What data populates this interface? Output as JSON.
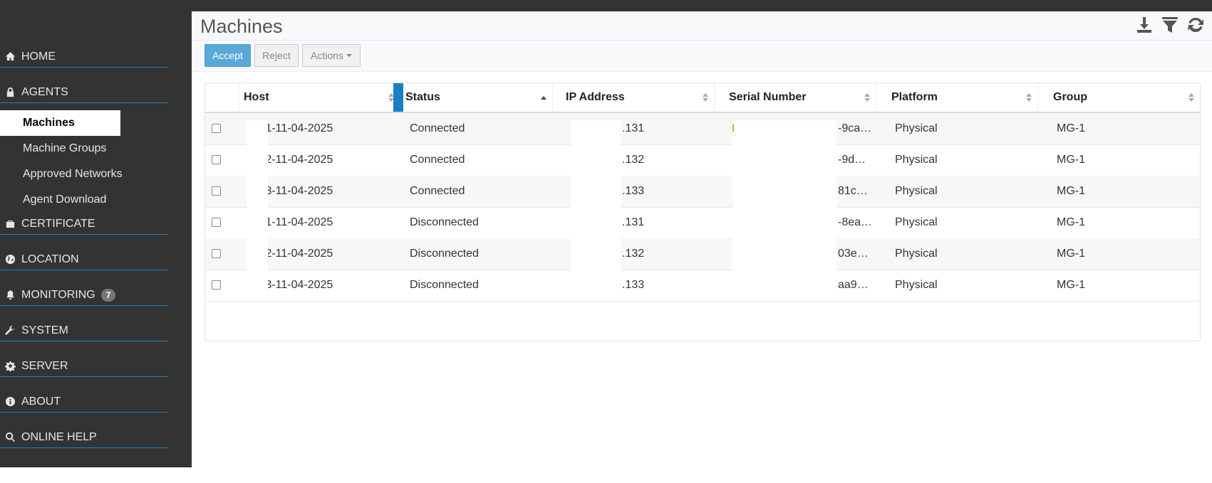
{
  "sidebar": {
    "items": [
      {
        "label": "HOME",
        "icon": "home-icon"
      },
      {
        "label": "AGENTS",
        "icon": "lock-icon"
      },
      {
        "label": "CERTIFICATE",
        "icon": "certificate-icon"
      },
      {
        "label": "LOCATION",
        "icon": "globe-icon"
      },
      {
        "label": "MONITORING",
        "icon": "bell-icon",
        "badge": "7"
      },
      {
        "label": "SYSTEM",
        "icon": "wrench-icon"
      },
      {
        "label": "SERVER",
        "icon": "gear-icon"
      },
      {
        "label": "ABOUT",
        "icon": "info-icon"
      },
      {
        "label": "ONLINE HELP",
        "icon": "search-icon"
      }
    ],
    "agents_sub": [
      "Machines",
      "Machine Groups",
      "Approved Networks",
      "Agent Download"
    ],
    "active_sub": "Machines"
  },
  "main": {
    "title": "Machines",
    "tools": [
      "download-icon",
      "filter-icon",
      "refresh-icon"
    ],
    "toolbar": {
      "accept": "Accept",
      "reject": "Reject",
      "actions": "Actions"
    },
    "columns": [
      "Host",
      "Status",
      "IP Address",
      "Serial Number",
      "Platform",
      "Group"
    ],
    "rows": [
      {
        "host": ":1-11-04-2025",
        "status": "Connected",
        "ip": ".131",
        "serial": "-9ca…",
        "platform": "Physical",
        "group": "MG-1"
      },
      {
        "host": ":2-11-04-2025",
        "status": "Connected",
        "ip": ".132",
        "serial": "-9d…",
        "platform": "Physical",
        "group": "MG-1"
      },
      {
        "host": ":3-11-04-2025",
        "status": "Connected",
        "ip": ".133",
        "serial": "81c…",
        "platform": "Physical",
        "group": "MG-1"
      },
      {
        "host": ":1-11-04-2025",
        "status": "Disconnected",
        "ip": ".131",
        "serial": "-8ea…",
        "platform": "Physical",
        "group": "MG-1"
      },
      {
        "host": ":2-11-04-2025",
        "status": "Disconnected",
        "ip": ".132",
        "serial": "03e…",
        "platform": "Physical",
        "group": "MG-1"
      },
      {
        "host": ":3-11-04-2025",
        "status": "Disconnected",
        "ip": ".133",
        "serial": "aa9…",
        "platform": "Physical",
        "group": "MG-1"
      }
    ]
  },
  "colors": {
    "sidebar_bg": "#333333",
    "accent": "#1a7fc4",
    "accept_btn": "#5aa8d8"
  }
}
